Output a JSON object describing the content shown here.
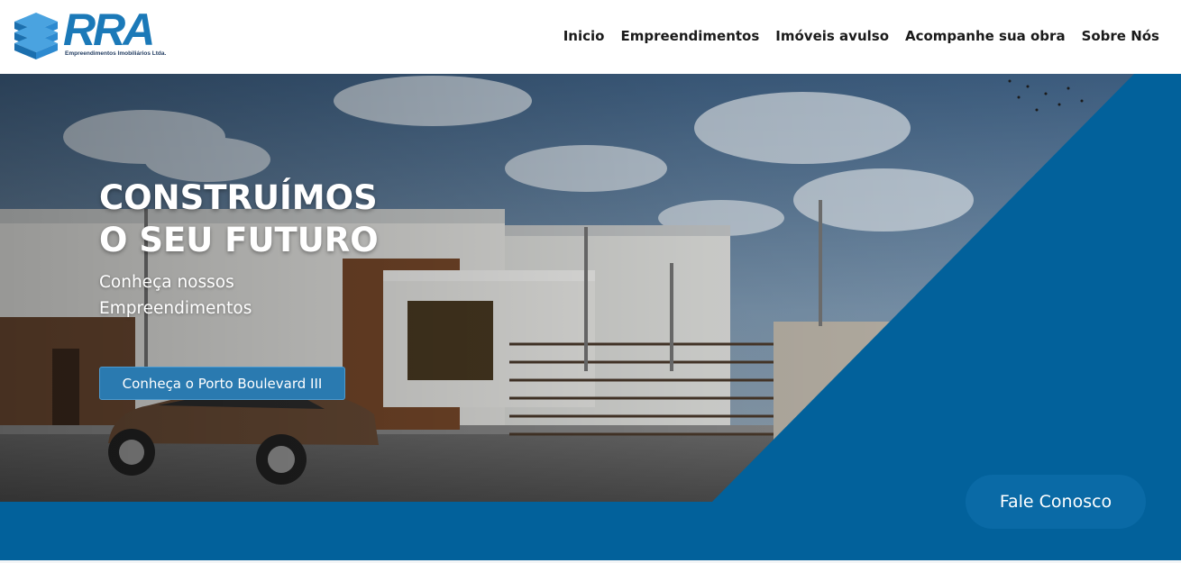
{
  "brand": {
    "name": "RRA",
    "tagline": "Empreendimentos Imobiliários Ltda.",
    "color": "#1b79b8"
  },
  "nav": {
    "items": [
      {
        "label": "Inicio"
      },
      {
        "label": "Empreendimentos"
      },
      {
        "label": "Imóveis avulso"
      },
      {
        "label": "Acompanhe sua obra"
      },
      {
        "label": "Sobre Nós"
      }
    ]
  },
  "hero": {
    "title_line1": "CONSTRUÍMOS",
    "title_line2": "O SEU FUTURO",
    "subtitle_line1": "Conheça nossos",
    "subtitle_line2": "Empreendimentos",
    "cta_label": "Conheça o Porto Boulevard III",
    "accent_color": "#02619b"
  },
  "contact": {
    "label": "Fale Conosco"
  }
}
